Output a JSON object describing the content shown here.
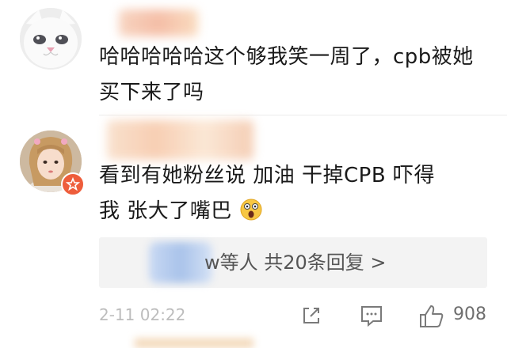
{
  "comments": [
    {
      "text": "哈哈哈哈哈这个够我笑一周了，cpb被她买下来了吗",
      "avatar_icon": "white-cat-avatar"
    },
    {
      "text_line1": "看到有她粉丝说 加油 干掉CPB 吓得",
      "text_line2": "我 张大了嘴巴",
      "avatar_icon": "girl-avatar",
      "badge_icon": "star-badge-icon",
      "emoji_icon": "shocked-face-emoji"
    }
  ],
  "replies": {
    "text": "w等人  共20条回复 >"
  },
  "footer": {
    "timestamp": "2-11 02:22",
    "like_count": "908",
    "share_icon": "share-icon",
    "comment_icon": "comment-icon",
    "like_icon": "thumbs-up-icon"
  },
  "colors": {
    "text": "#1a1a1a",
    "muted": "#bdbdbd",
    "reply_bg": "#f3f3f3",
    "badge": "#ee5d3b"
  }
}
